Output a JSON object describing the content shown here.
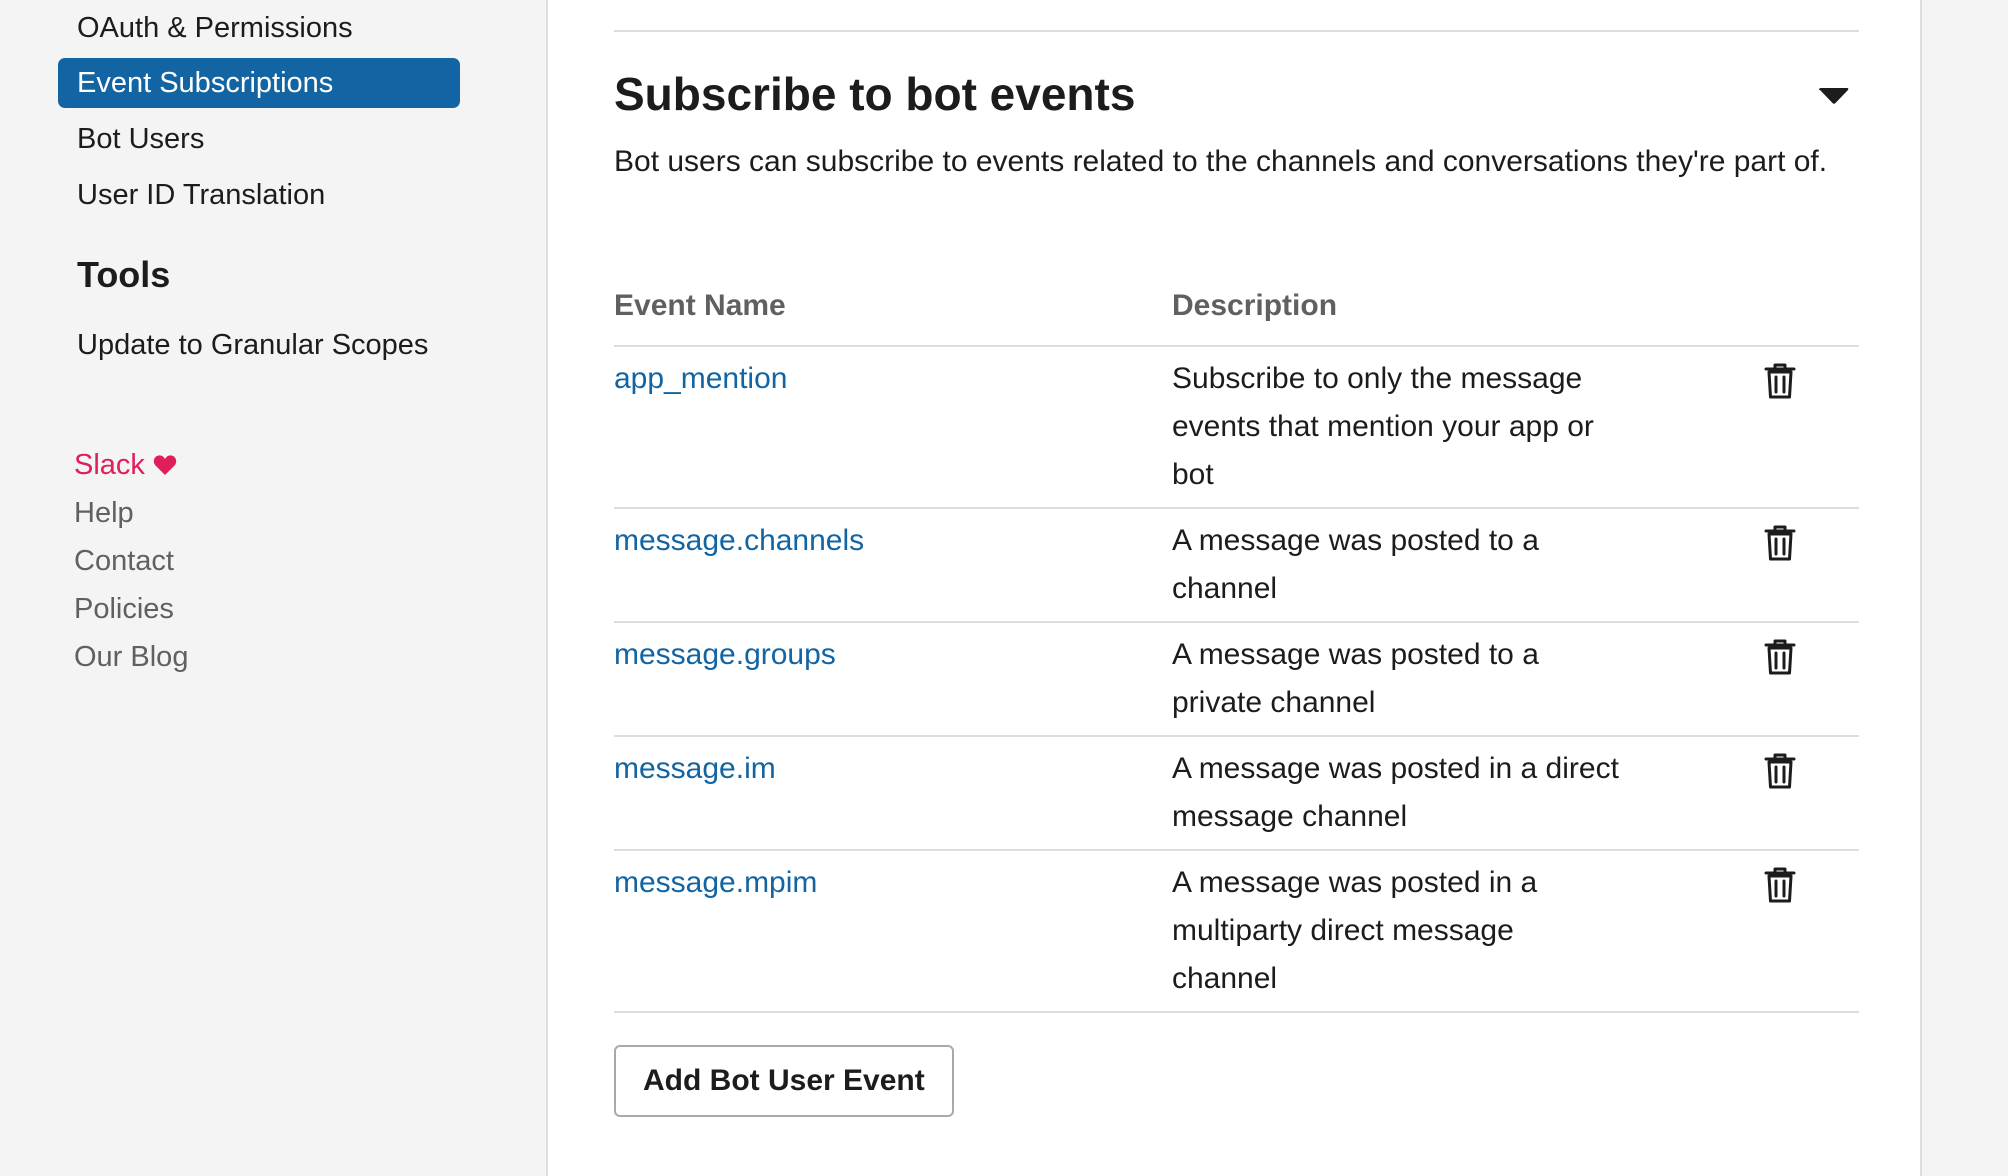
{
  "sidebar": {
    "items": [
      {
        "label": "OAuth & Permissions",
        "active": false
      },
      {
        "label": "Event Subscriptions",
        "active": true
      },
      {
        "label": "Bot Users",
        "active": false
      },
      {
        "label": "User ID Translation",
        "active": false
      }
    ],
    "tools_heading": "Tools",
    "tools_items": [
      {
        "label": "Update to Granular Scopes"
      }
    ],
    "footer_links": [
      "Slack",
      "Help",
      "Contact",
      "Policies",
      "Our Blog"
    ]
  },
  "section": {
    "title": "Subscribe to bot events",
    "description": "Bot users can subscribe to events related to the channels and conversations they're part of.",
    "table": {
      "headers": {
        "event_name": "Event Name",
        "description": "Description"
      },
      "rows": [
        {
          "name": "app_mention",
          "description": "Subscribe to only the message events that mention your app or bot"
        },
        {
          "name": "message.channels",
          "description": "A message was posted to a channel"
        },
        {
          "name": "message.groups",
          "description": "A message was posted to a private channel"
        },
        {
          "name": "message.im",
          "description": "A message was posted in a direct message channel"
        },
        {
          "name": "message.mpim",
          "description": "A message was posted in a multiparty direct message channel"
        }
      ]
    },
    "add_button_label": "Add Bot User Event"
  },
  "icons": {
    "collapse": "caret-down-icon",
    "delete": "trash-icon",
    "heart": "heart-icon"
  },
  "colors": {
    "accent": "#1264a3",
    "active_nav_bg": "#1264a3",
    "slack_pink": "#e01e5a",
    "muted_text": "#616061"
  }
}
